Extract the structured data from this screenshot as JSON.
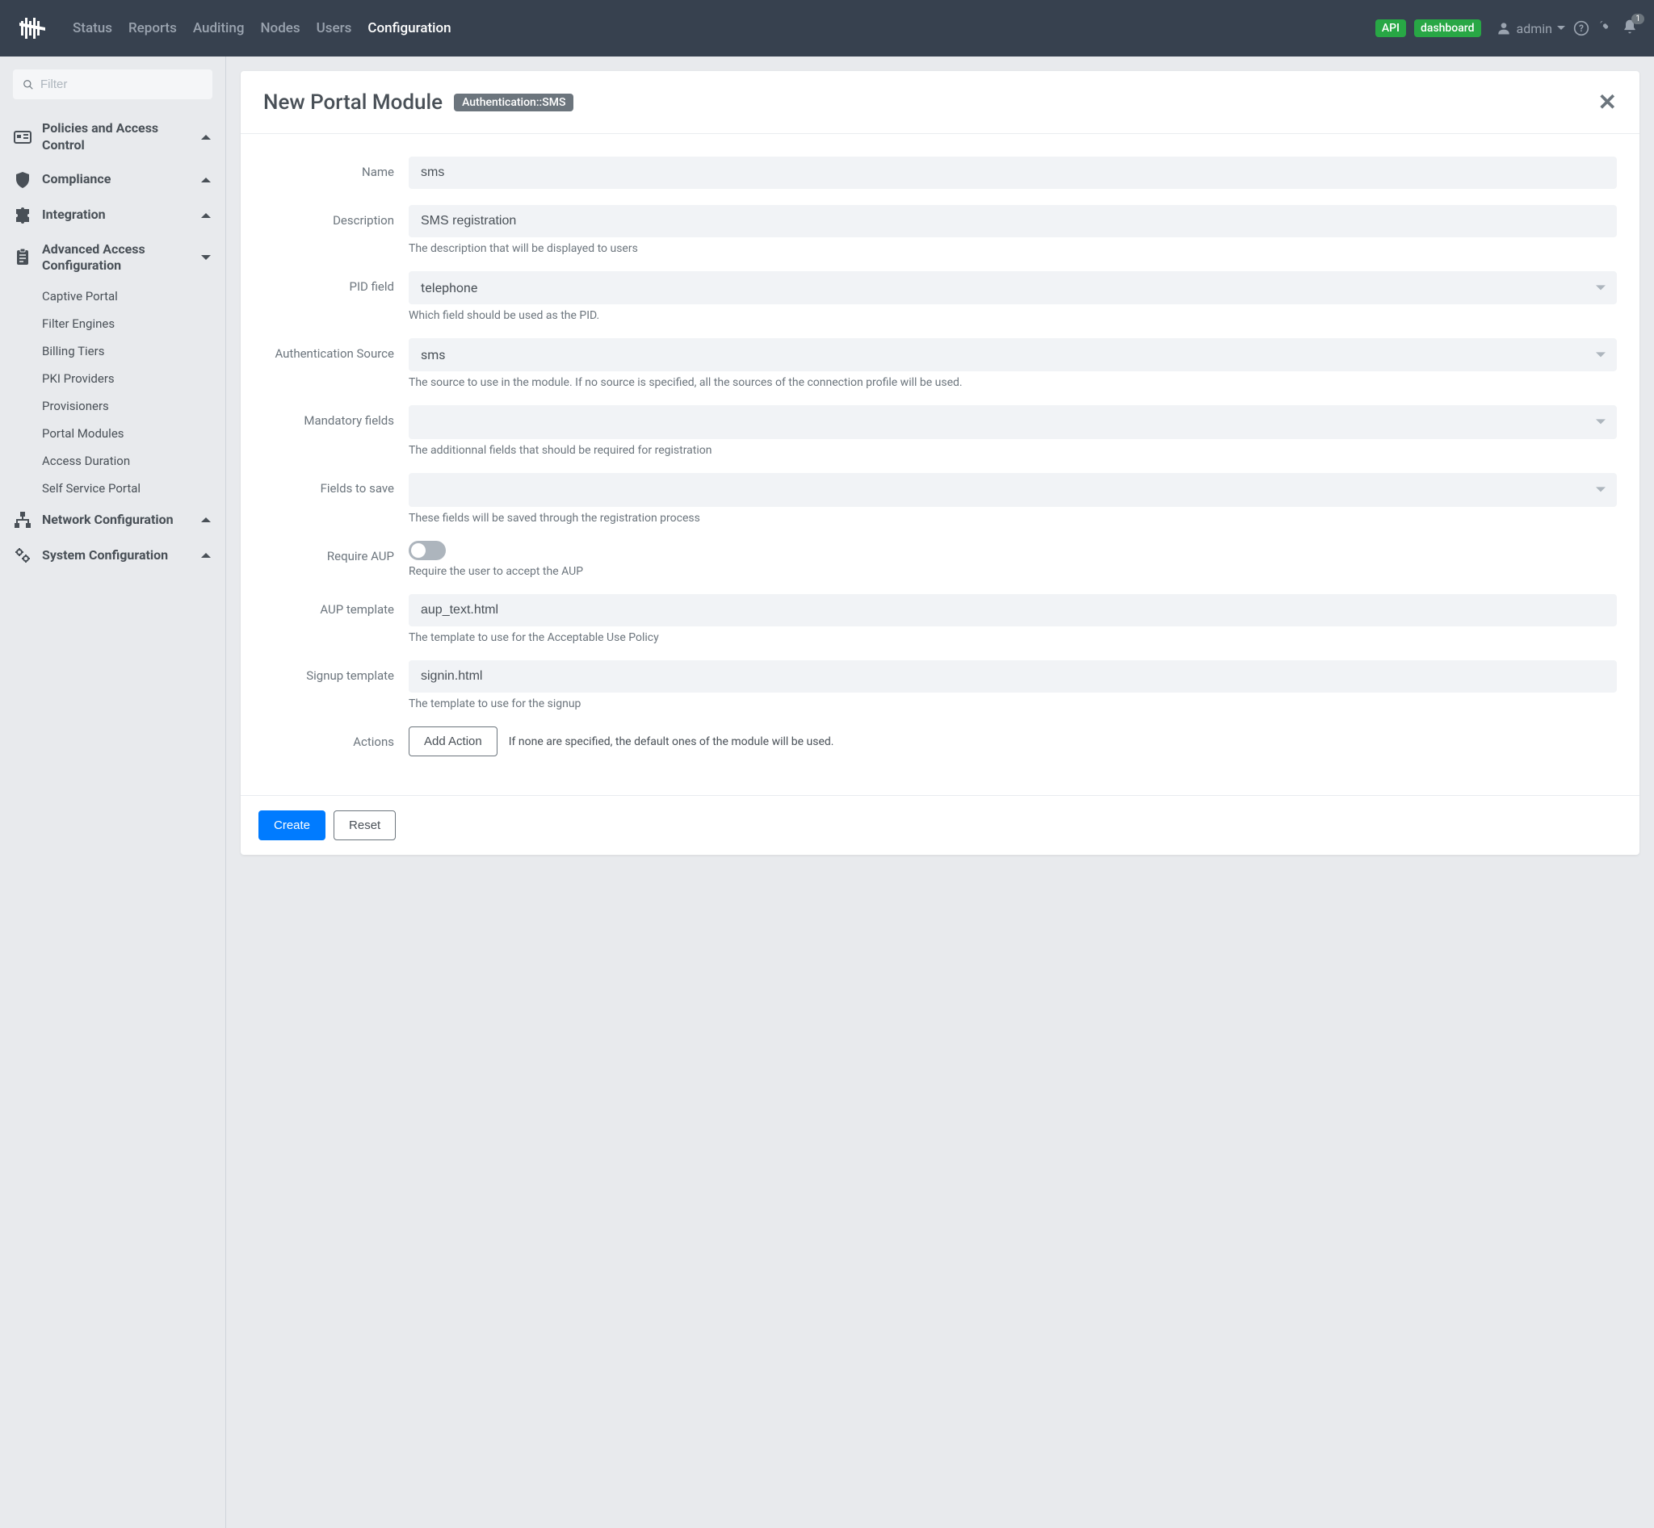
{
  "navbar": {
    "links": {
      "status": "Status",
      "reports": "Reports",
      "auditing": "Auditing",
      "nodes": "Nodes",
      "users": "Users",
      "configuration": "Configuration"
    },
    "badges": {
      "api": "API",
      "dashboard": "dashboard"
    },
    "user": "admin",
    "notification_count": "1"
  },
  "sidebar": {
    "filter_placeholder": "Filter",
    "policies": "Policies and Access Control",
    "compliance": "Compliance",
    "integration": "Integration",
    "advanced": "Advanced Access Configuration",
    "advanced_items": {
      "captive": "Captive Portal",
      "filter": "Filter Engines",
      "billing": "Billing Tiers",
      "pki": "PKI Providers",
      "provisioners": "Provisioners",
      "portal": "Portal Modules",
      "access": "Access Duration",
      "selfservice": "Self Service Portal"
    },
    "network": "Network Configuration",
    "system": "System Configuration"
  },
  "card": {
    "title": "New Portal Module",
    "badge": "Authentication::SMS"
  },
  "form": {
    "name": {
      "label": "Name",
      "value": "sms"
    },
    "description": {
      "label": "Description",
      "value": "SMS registration",
      "help": "The description that will be displayed to users"
    },
    "pid": {
      "label": "PID field",
      "value": "telephone",
      "help": "Which field should be used as the PID."
    },
    "auth": {
      "label": "Authentication Source",
      "value": "sms",
      "help": "The source to use in the module. If no source is specified, all the sources of the connection profile will be used."
    },
    "mandatory": {
      "label": "Mandatory fields",
      "value": "",
      "help": "The additionnal fields that should be required for registration"
    },
    "save": {
      "label": "Fields to save",
      "value": "",
      "help": "These fields will be saved through the registration process"
    },
    "aup": {
      "label": "Require AUP",
      "help": "Require the user to accept the AUP"
    },
    "aup_template": {
      "label": "AUP template",
      "value": "aup_text.html",
      "help": "The template to use for the Acceptable Use Policy"
    },
    "signup": {
      "label": "Signup template",
      "value": "signin.html",
      "help": "The template to use for the signup"
    },
    "actions": {
      "label": "Actions",
      "button": "Add Action",
      "help": "If none are specified, the default ones of the module will be used."
    }
  },
  "footer": {
    "create": "Create",
    "reset": "Reset"
  }
}
